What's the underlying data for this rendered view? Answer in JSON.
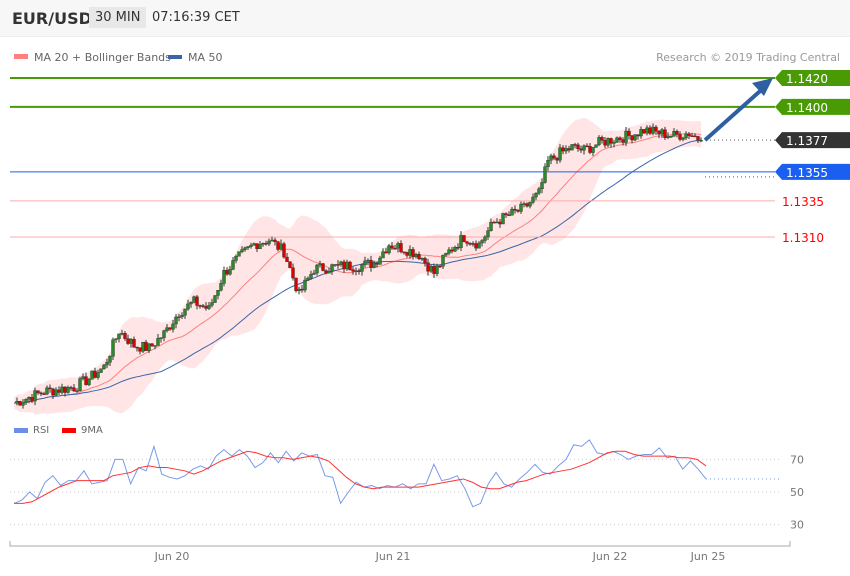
{
  "header": {
    "symbol": "EUR/USD",
    "timeframe": "30 MIN",
    "time": "07:16:39 CET"
  },
  "legend": {
    "ma20": "MA 20 + Bollinger Bands",
    "ma50": "MA 50",
    "ma20_color": "#ff7f7f",
    "ma50_color": "#3a66a8"
  },
  "copyright": "Research © 2019 Trading Central",
  "chart_data": [
    {
      "type": "candlestick",
      "title": "EUR/USD 30 MIN",
      "price_path": [
        [
          0,
          1.1195
        ],
        [
          10,
          1.1203
        ],
        [
          20,
          1.1206
        ],
        [
          25,
          1.1212
        ],
        [
          30,
          1.122
        ],
        [
          35,
          1.1245
        ],
        [
          40,
          1.1235
        ],
        [
          45,
          1.1233
        ],
        [
          50,
          1.1243
        ],
        [
          55,
          1.1258
        ],
        [
          60,
          1.1265
        ],
        [
          65,
          1.126
        ],
        [
          70,
          1.1285
        ],
        [
          75,
          1.1296
        ],
        [
          80,
          1.1305
        ],
        [
          85,
          1.1308
        ],
        [
          90,
          1.13
        ],
        [
          95,
          1.127
        ],
        [
          100,
          1.1288
        ],
        [
          110,
          1.129
        ],
        [
          115,
          1.129
        ],
        [
          120,
          1.1292
        ],
        [
          125,
          1.1305
        ],
        [
          130,
          1.1302
        ],
        [
          135,
          1.1298
        ],
        [
          140,
          1.1285
        ],
        [
          145,
          1.13
        ],
        [
          150,
          1.131
        ],
        [
          155,
          1.1305
        ],
        [
          160,
          1.132
        ],
        [
          165,
          1.1325
        ],
        [
          170,
          1.133
        ],
        [
          175,
          1.134
        ],
        [
          178,
          1.1362
        ],
        [
          182,
          1.1368
        ],
        [
          186,
          1.1372
        ],
        [
          190,
          1.137
        ],
        [
          195,
          1.1375
        ],
        [
          200,
          1.1378
        ],
        [
          205,
          1.138
        ],
        [
          210,
          1.1384
        ],
        [
          215,
          1.1382
        ],
        [
          220,
          1.138
        ],
        [
          225,
          1.1382
        ],
        [
          229,
          1.1377
        ]
      ],
      "levels": [
        {
          "label": "1.1420",
          "value": 1.142,
          "color": "#4a9a06",
          "type": "target"
        },
        {
          "label": "1.1400",
          "value": 1.14,
          "color": "#4a9a06",
          "type": "target"
        },
        {
          "label": "1.1377",
          "value": 1.1377,
          "color": "#333333",
          "type": "last"
        },
        {
          "label": "1.1355",
          "value": 1.1355,
          "color": "#1a5ff0",
          "type": "pivot"
        },
        {
          "label": "1.1335",
          "value": 1.1335,
          "color": "#ff0000",
          "type": "support"
        },
        {
          "label": "1.1310",
          "value": 1.131,
          "color": "#ff0000",
          "type": "support"
        }
      ],
      "arrow": {
        "from": 1.1377,
        "to": 1.142,
        "direction": "up"
      }
    },
    {
      "type": "line",
      "legend": [
        "RSI",
        "9MA"
      ],
      "yticks": [
        70,
        50,
        30
      ],
      "xticks": [
        "Jun 20",
        "Jun 21",
        "Jun 22",
        "Jun 25"
      ],
      "rsi": [
        43,
        45,
        50,
        46,
        56,
        60,
        54,
        57,
        57,
        63,
        55,
        56,
        57,
        70,
        70,
        55,
        65,
        63,
        78,
        61,
        59,
        58,
        60,
        64,
        66,
        64,
        72,
        76,
        72,
        76,
        72,
        65,
        68,
        74,
        68,
        75,
        69,
        74,
        72,
        73,
        60,
        59,
        43,
        50,
        56,
        53,
        54,
        52,
        54,
        53,
        55,
        52,
        55,
        55,
        67,
        57,
        58,
        60,
        52,
        41,
        43,
        55,
        62,
        55,
        53,
        58,
        62,
        67,
        62,
        61,
        66,
        70,
        79,
        78,
        82,
        74,
        73,
        75,
        73,
        70,
        72,
        73,
        73,
        77,
        71,
        72,
        64,
        69,
        64,
        58
      ],
      "ma9": [
        43,
        43,
        44,
        47,
        50,
        53,
        55,
        57,
        57,
        57,
        57,
        60,
        61,
        62,
        65,
        66,
        65,
        65,
        64,
        63,
        61,
        63,
        66,
        69,
        71,
        73,
        75,
        74,
        72,
        71,
        71,
        70,
        71,
        72,
        71,
        69,
        64,
        59,
        55,
        53,
        52,
        53,
        53,
        53,
        53,
        53,
        54,
        55,
        56,
        57,
        58,
        56,
        53,
        52,
        52,
        54,
        56,
        57,
        59,
        61,
        62,
        63,
        64,
        66,
        68,
        71,
        74,
        75,
        75,
        73,
        72,
        72,
        72,
        72,
        71,
        71,
        70,
        66
      ]
    }
  ],
  "rsi_legend": {
    "rsi": "RSI",
    "ma9": "9MA"
  },
  "x_labels": [
    "Jun 20",
    "Jun 21",
    "Jun 22",
    "Jun 25"
  ]
}
